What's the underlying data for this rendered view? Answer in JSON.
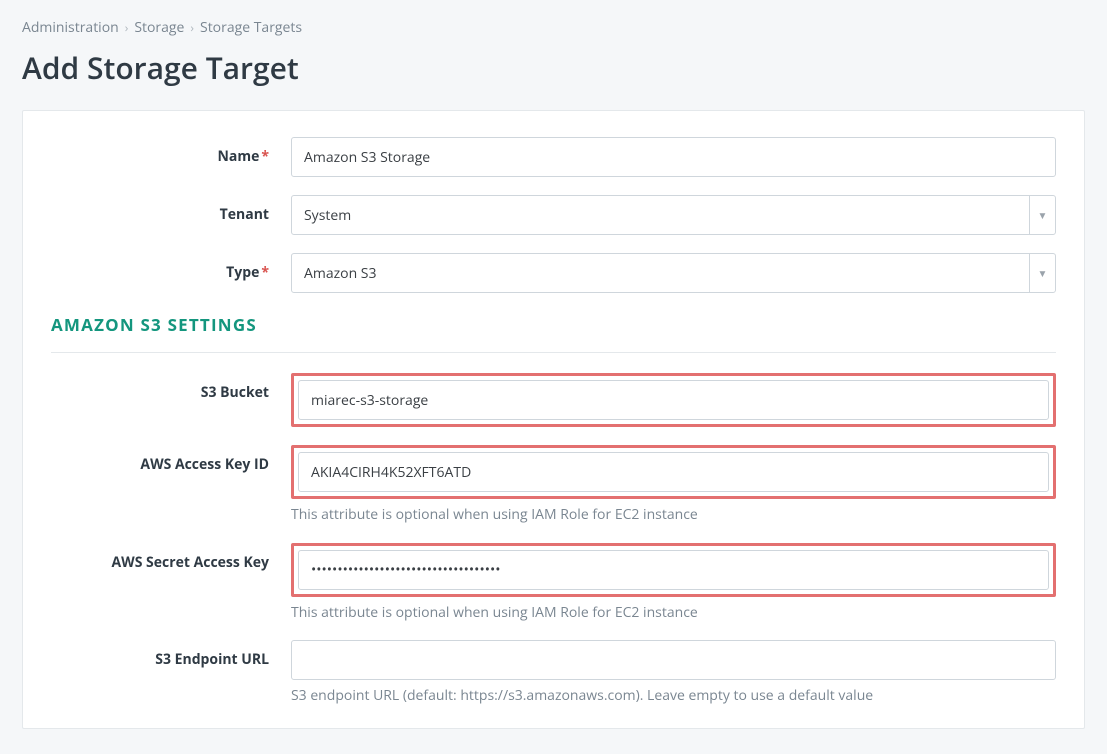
{
  "breadcrumb": {
    "item1": "Administration",
    "item2": "Storage",
    "item3": "Storage Targets"
  },
  "page_title": "Add Storage Target",
  "fields": {
    "name": {
      "label": "Name",
      "value": "Amazon S3 Storage"
    },
    "tenant": {
      "label": "Tenant",
      "value": "System"
    },
    "type": {
      "label": "Type",
      "value": "Amazon S3"
    }
  },
  "section_title": "AMAZON S3 SETTINGS",
  "s3": {
    "bucket": {
      "label": "S3 Bucket",
      "value": "miarec-s3-storage"
    },
    "access_key": {
      "label": "AWS Access Key ID",
      "value": "AKIA4CIRH4K52XFT6ATD",
      "help": "This attribute is optional when using IAM Role for EC2 instance"
    },
    "secret": {
      "label": "AWS Secret Access Key",
      "value": "••••••••••••••••••••••••••••••••••••",
      "help": "This attribute is optional when using IAM Role for EC2 instance"
    },
    "endpoint": {
      "label": "S3 Endpoint URL",
      "value": "",
      "help": "S3 endpoint URL (default: https://s3.amazonaws.com). Leave empty to use a default value"
    }
  }
}
